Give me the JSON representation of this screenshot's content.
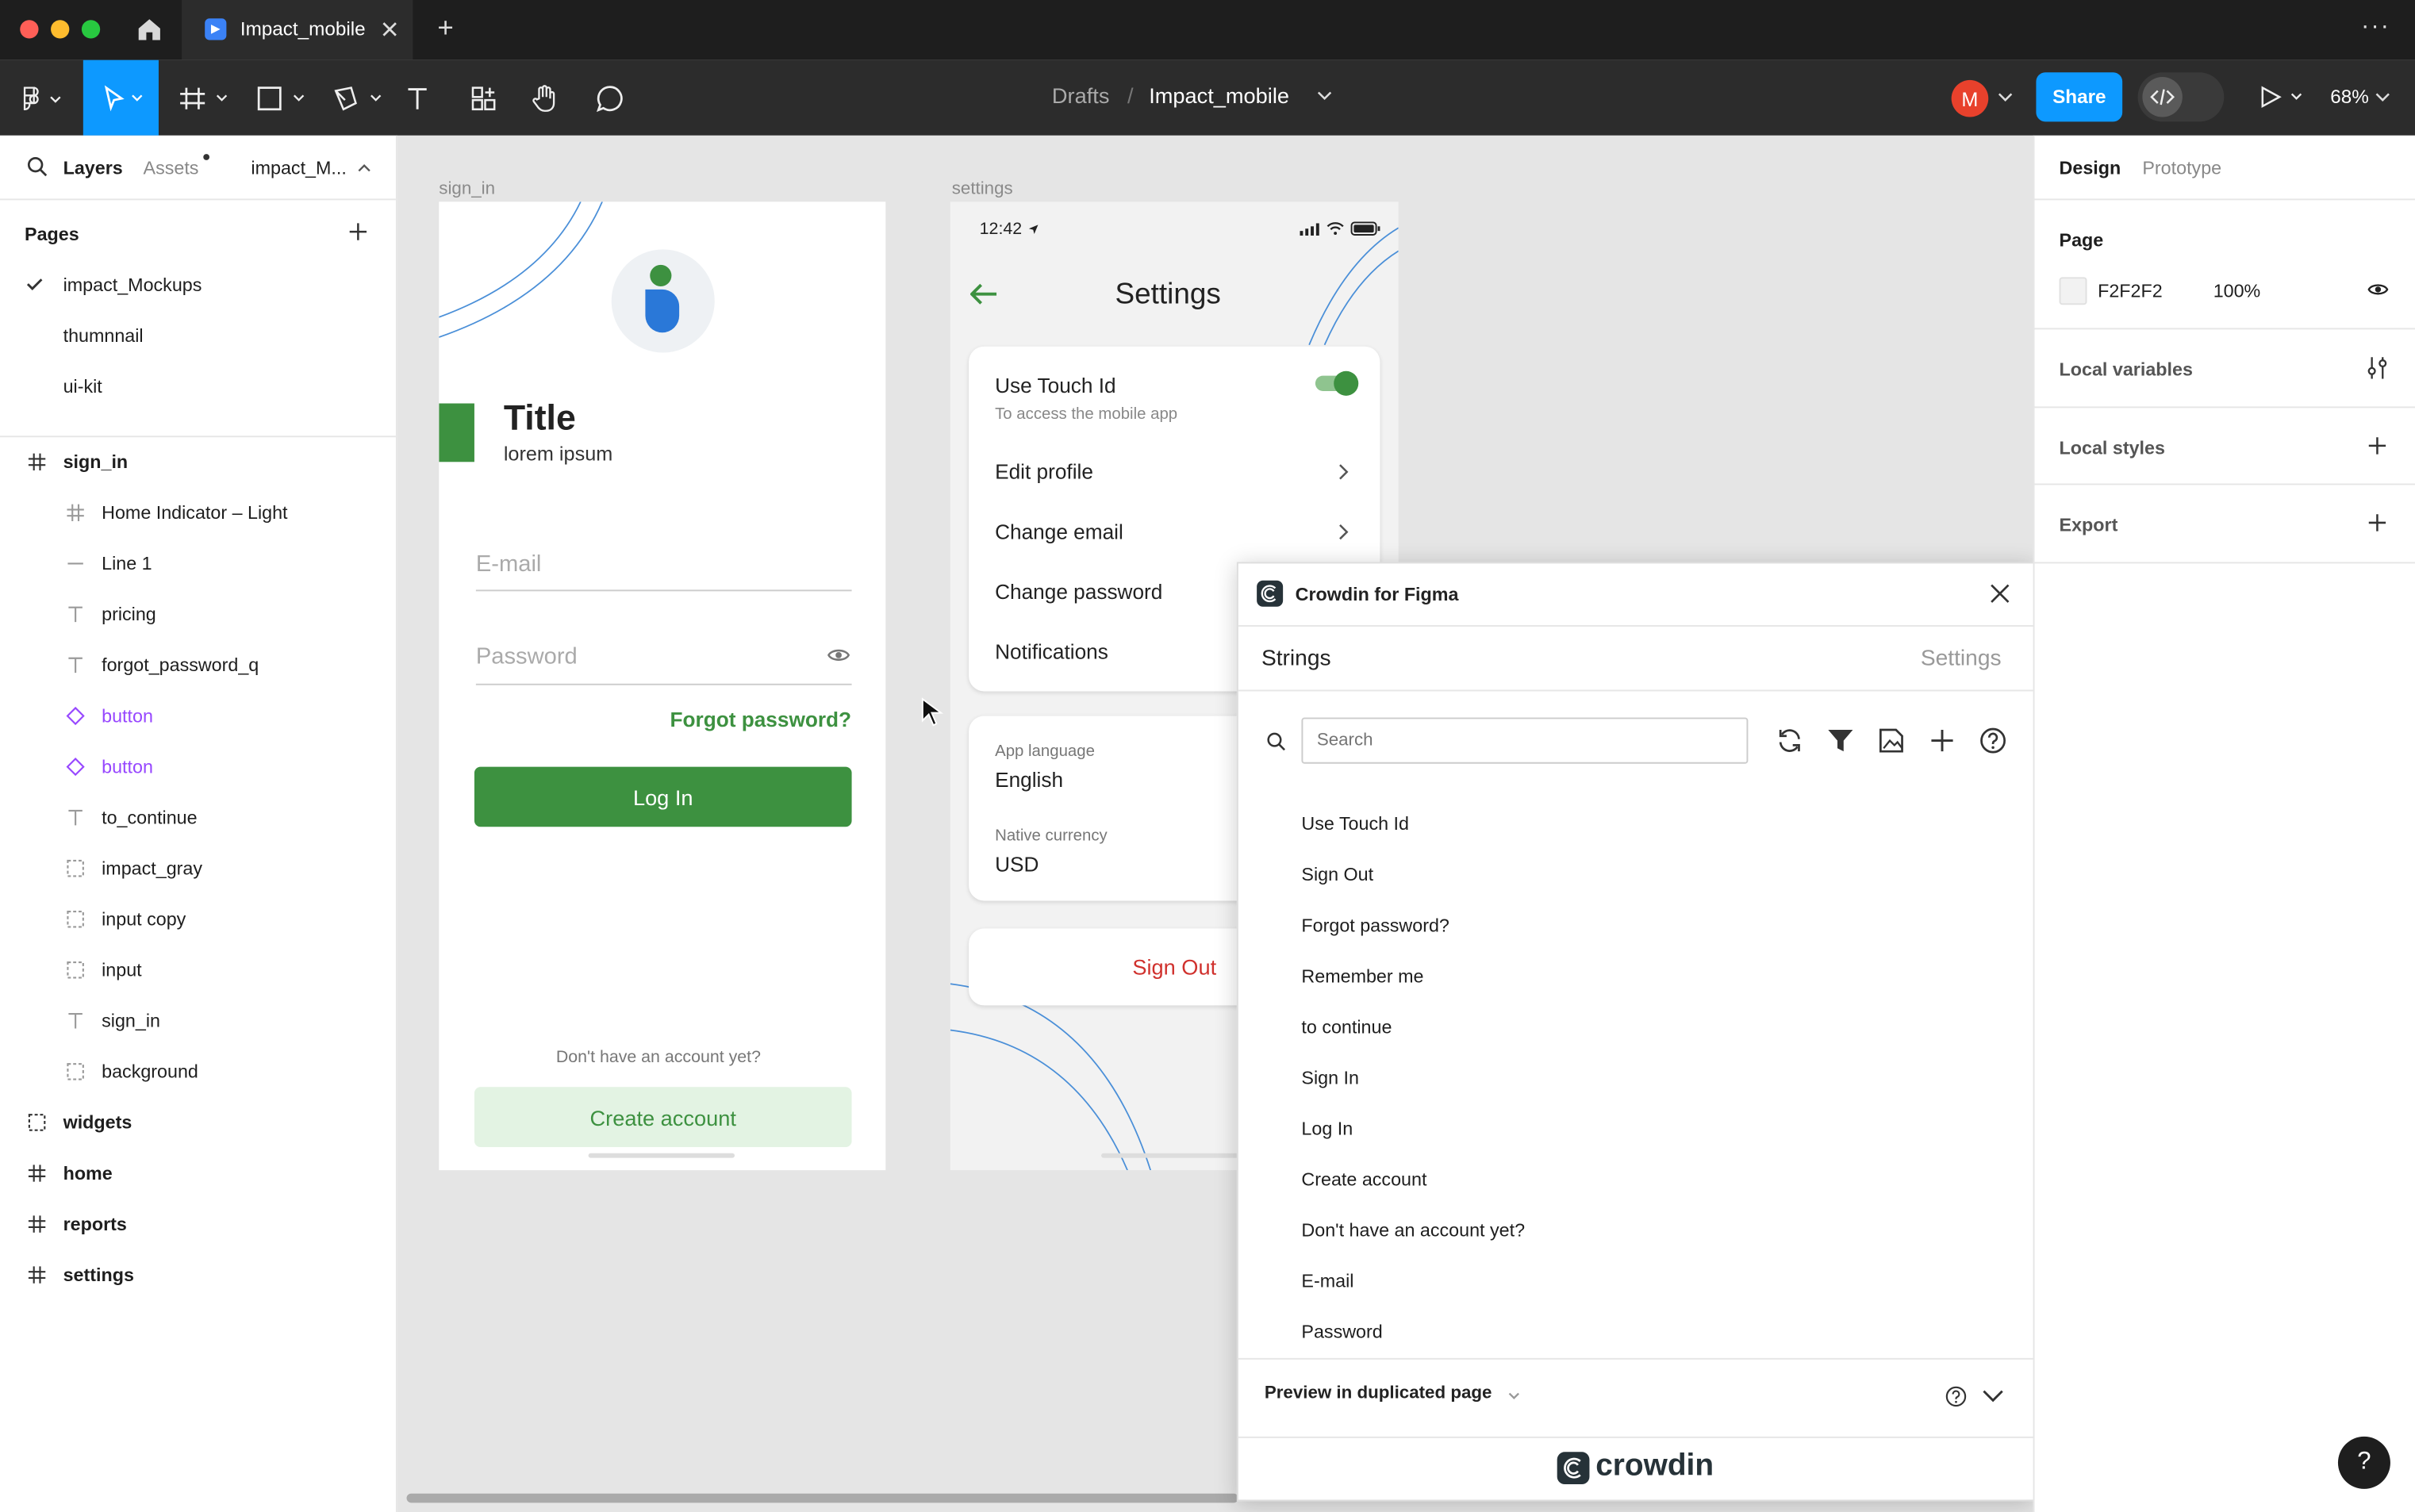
{
  "titlebar": {
    "tab_title": "Impact_mobile",
    "add_tab": "+",
    "more": "···"
  },
  "toolbar": {
    "breadcrumb_parent": "Drafts",
    "breadcrumb_sep": "/",
    "file_name": "Impact_mobile",
    "avatar_letter": "M",
    "share_label": "Share",
    "zoom": "68%"
  },
  "left_panel": {
    "tabs": {
      "layers": "Layers",
      "assets": "Assets",
      "page_short": "impact_M..."
    },
    "pages_heading": "Pages",
    "pages": [
      "impact_Mockups",
      "thumnnail",
      "ui-kit"
    ],
    "layers": [
      {
        "label": "sign_in",
        "icon": "frame-icon"
      },
      {
        "label": "Home Indicator – Light",
        "icon": "frame-icon"
      },
      {
        "label": "Line 1",
        "icon": "line-icon"
      },
      {
        "label": "pricing",
        "icon": "text-icon"
      },
      {
        "label": "forgot_password_q",
        "icon": "text-icon"
      },
      {
        "label": "button",
        "icon": "instance-icon"
      },
      {
        "label": "button",
        "icon": "instance-icon"
      },
      {
        "label": "to_continue",
        "icon": "text-icon"
      },
      {
        "label": "impact_gray",
        "icon": "group-icon"
      },
      {
        "label": "input copy",
        "icon": "group-icon"
      },
      {
        "label": "input",
        "icon": "group-icon"
      },
      {
        "label": "sign_in",
        "icon": "text-icon"
      },
      {
        "label": "background",
        "icon": "group-icon"
      },
      {
        "label": "widgets",
        "icon": "group-icon"
      },
      {
        "label": "home",
        "icon": "frame-icon"
      },
      {
        "label": "reports",
        "icon": "frame-icon"
      },
      {
        "label": "settings",
        "icon": "frame-icon"
      }
    ]
  },
  "right_panel": {
    "tabs": {
      "design": "Design",
      "prototype": "Prototype"
    },
    "page_heading": "Page",
    "page_color": "F2F2F2",
    "page_opacity": "100%",
    "page_color_swatch": "#f2f2f2",
    "local_variables": "Local variables",
    "local_styles": "Local styles",
    "export": "Export"
  },
  "canvas": {
    "signin_label": "sign_in",
    "settings_label": "settings",
    "signin": {
      "title": "Title",
      "subtitle": "lorem ipsum",
      "email_placeholder": "E-mail",
      "password_placeholder": "Password",
      "forgot": "Forgot password?",
      "login": "Log In",
      "no_account": "Don't have an account yet?",
      "create_account": "Create account"
    },
    "settings": {
      "time": "12:42",
      "title": "Settings",
      "touch_id": "Use Touch Id",
      "touch_id_sub": "To access the mobile app",
      "edit_profile": "Edit profile",
      "change_email": "Change email",
      "change_password": "Change password",
      "notifications": "Notifications",
      "app_language_label": "App language",
      "app_language": "English",
      "native_currency_label": "Native currency",
      "native_currency": "USD",
      "sign_out": "Sign Out"
    }
  },
  "plugin": {
    "title": "Crowdin for Figma",
    "tab_strings": "Strings",
    "tab_settings": "Settings",
    "search_placeholder": "Search",
    "strings": [
      "Use Touch Id",
      "Sign Out",
      "Forgot password?",
      "Remember me",
      "to continue",
      "Sign In",
      "Log In",
      "Create account",
      "Don't have an account yet?",
      "E-mail",
      "Password"
    ],
    "preview_label": "Preview in duplicated page",
    "brand": "crowdin"
  },
  "help_button": "?",
  "colors": {
    "accent": "#0d99ff",
    "green": "#3d9140",
    "red": "#d0312d",
    "avatar": "#e8412c"
  }
}
